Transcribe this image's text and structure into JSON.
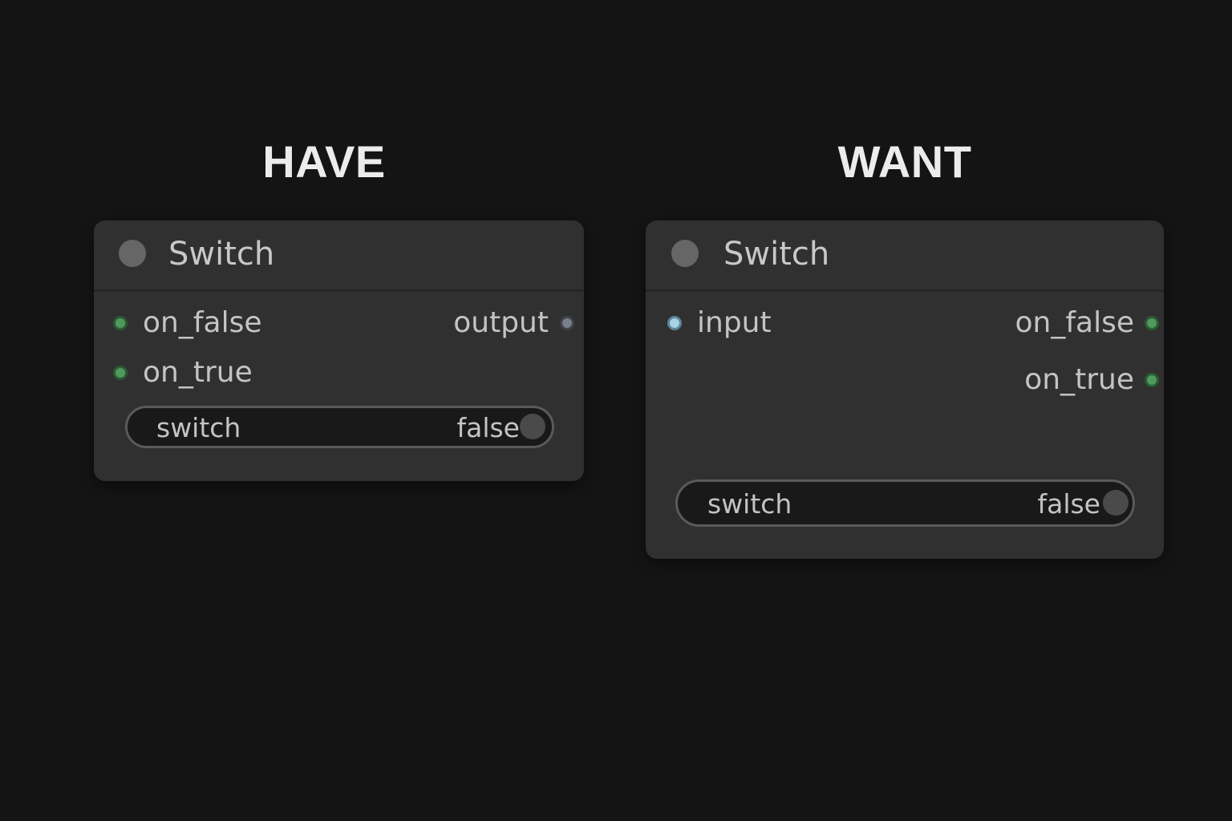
{
  "panels": {
    "have": {
      "title": "HAVE",
      "node": {
        "title": "Switch",
        "inputs": [
          "on_false",
          "on_true"
        ],
        "outputs": [
          "output"
        ],
        "widget": {
          "name": "switch",
          "value": "false"
        }
      }
    },
    "want": {
      "title": "WANT",
      "node": {
        "title": "Switch",
        "inputs": [
          "input"
        ],
        "outputs": [
          "on_false",
          "on_true"
        ],
        "widget": {
          "name": "switch",
          "value": "false"
        }
      }
    }
  },
  "colors": {
    "background": "#141414",
    "node_body": "#303030",
    "slot_green": "#4f9a5a",
    "slot_grey": "#7a7f8c",
    "slot_blue": "#a6d3e6"
  },
  "icons": {
    "node_status": "circle-dot-icon",
    "toggle": "toggle-knob-icon"
  }
}
